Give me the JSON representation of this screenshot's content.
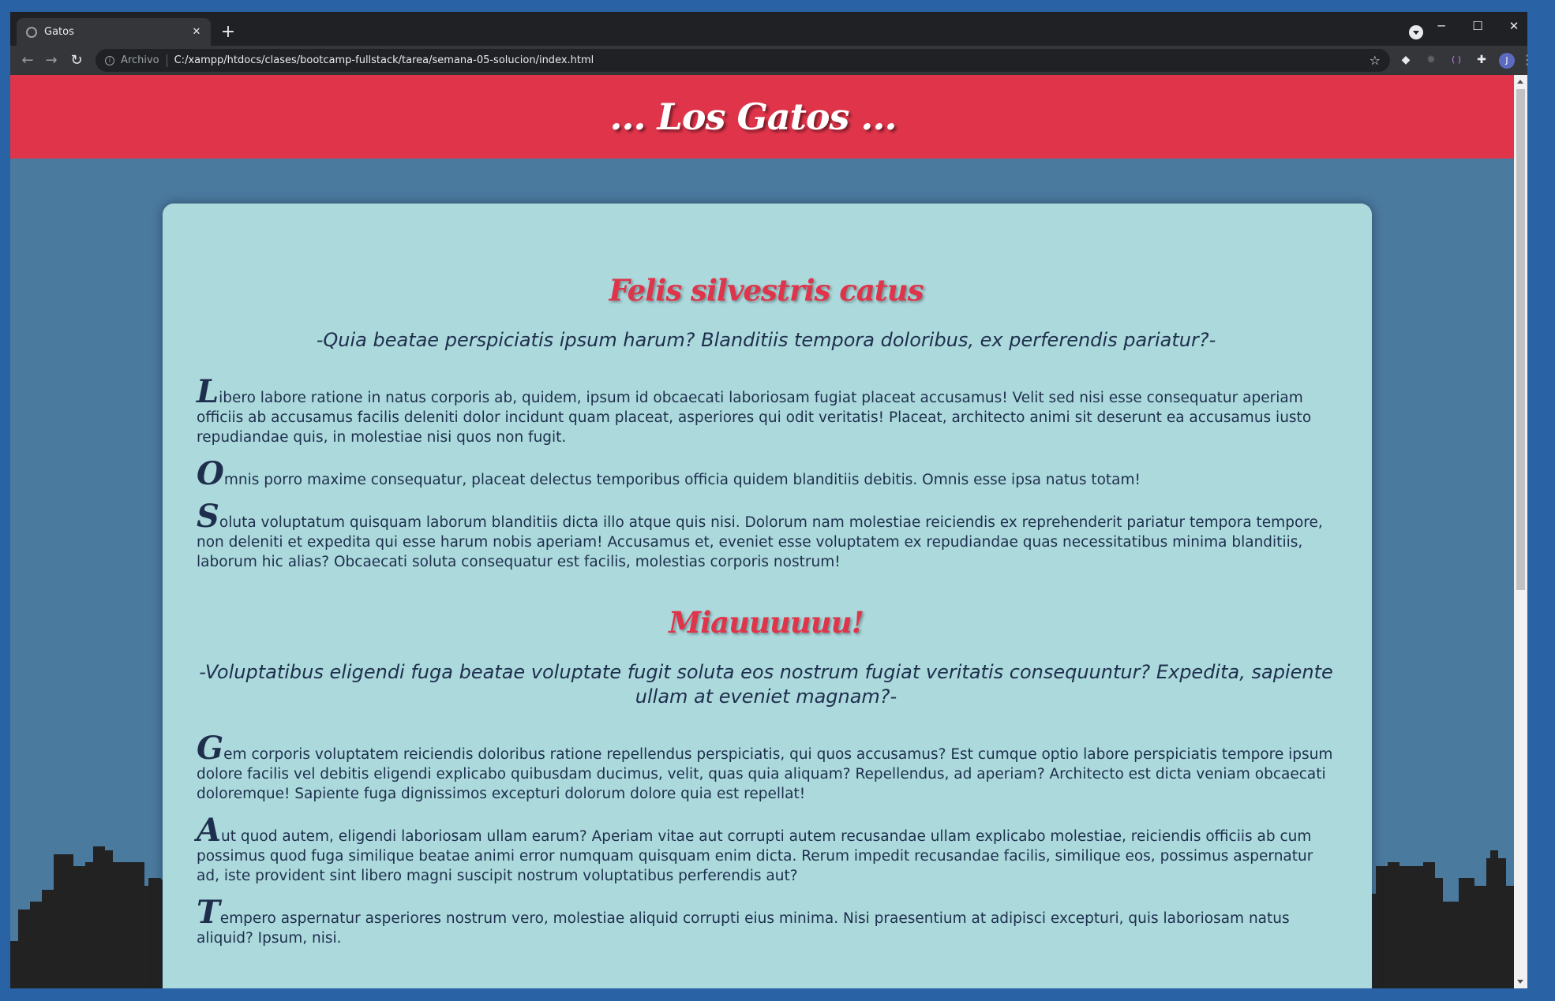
{
  "browser": {
    "tab_title": "Gatos",
    "tab_close": "✕",
    "new_tab": "+",
    "scheme_label": "Archivo",
    "url": "C:/xampp/htdocs/clases/bootcamp-fullstack/tarea/semana-05-solucion/index.html",
    "star": "☆",
    "avatar_initial": "J",
    "minimize": "─",
    "maximize": "☐",
    "close": "✕"
  },
  "page": {
    "header_title": "... Los Gatos ...",
    "sections": [
      {
        "title": "Felis silvestris catus",
        "subtitle": "-Quia beatae perspiciatis ipsum harum? Blanditiis tempora doloribus, ex perferendis pariatur?-",
        "paragraphs": [
          {
            "cap": "L",
            "text": "ibero labore ratione in natus corporis ab, quidem, ipsum id obcaecati laboriosam fugiat placeat accusamus! Velit sed nisi esse consequatur aperiam officiis ab accusamus facilis deleniti dolor incidunt quam placeat, asperiores qui odit veritatis! Placeat, architecto animi sit deserunt ea accusamus iusto repudiandae quis, in molestiae nisi quos non fugit."
          },
          {
            "cap": "O",
            "text": "mnis porro maxime consequatur, placeat delectus temporibus officia quidem blanditiis debitis. Omnis esse ipsa natus totam!"
          },
          {
            "cap": "S",
            "text": "oluta voluptatum quisquam laborum blanditiis dicta illo atque quis nisi. Dolorum nam molestiae reiciendis ex reprehenderit pariatur tempora tempore, non deleniti et expedita qui esse harum nobis aperiam! Accusamus et, eveniet esse voluptatem ex repudiandae quas necessitatibus minima blanditiis, laborum hic alias? Obcaecati soluta consequatur est facilis, molestias corporis nostrum!"
          }
        ]
      },
      {
        "title": "Miauuuuuu!",
        "subtitle": "-Voluptatibus eligendi fuga beatae voluptate fugit soluta eos nostrum fugiat veritatis consequuntur? Expedita, sapiente ullam at eveniet magnam?-",
        "paragraphs": [
          {
            "cap": "G",
            "text": "em corporis voluptatem reiciendis doloribus ratione repellendus perspiciatis, qui quos accusamus? Est cumque optio labore perspiciatis tempore ipsum dolore facilis vel debitis eligendi explicabo quibusdam ducimus, velit, quas quia aliquam? Repellendus, ad aperiam? Architecto est dicta veniam obcaecati doloremque! Sapiente fuga dignissimos excepturi dolorum dolore quia est repellat!"
          },
          {
            "cap": "A",
            "text": "ut quod autem, eligendi laboriosam ullam earum? Aperiam vitae aut corrupti autem recusandae ullam explicabo molestiae, reiciendis officiis ab cum possimus quod fuga similique beatae animi error numquam quisquam enim dicta. Rerum impedit recusandae facilis, similique eos, possimus aspernatur ad, iste provident sint libero magni suscipit nostrum voluptatibus perferendis aut?"
          },
          {
            "cap": "T",
            "text": "empero aspernatur asperiores nostrum vero, molestiae aliquid corrupti eius minima. Nisi praesentium at adipisci excepturi, quis laboriosam natus aliquid? Ipsum, nisi."
          }
        ]
      }
    ]
  },
  "colors": {
    "header_bg": "#e0344a",
    "page_bg": "#4b7a9f",
    "card_bg": "#acd9dc",
    "text": "#1e2f4d"
  }
}
